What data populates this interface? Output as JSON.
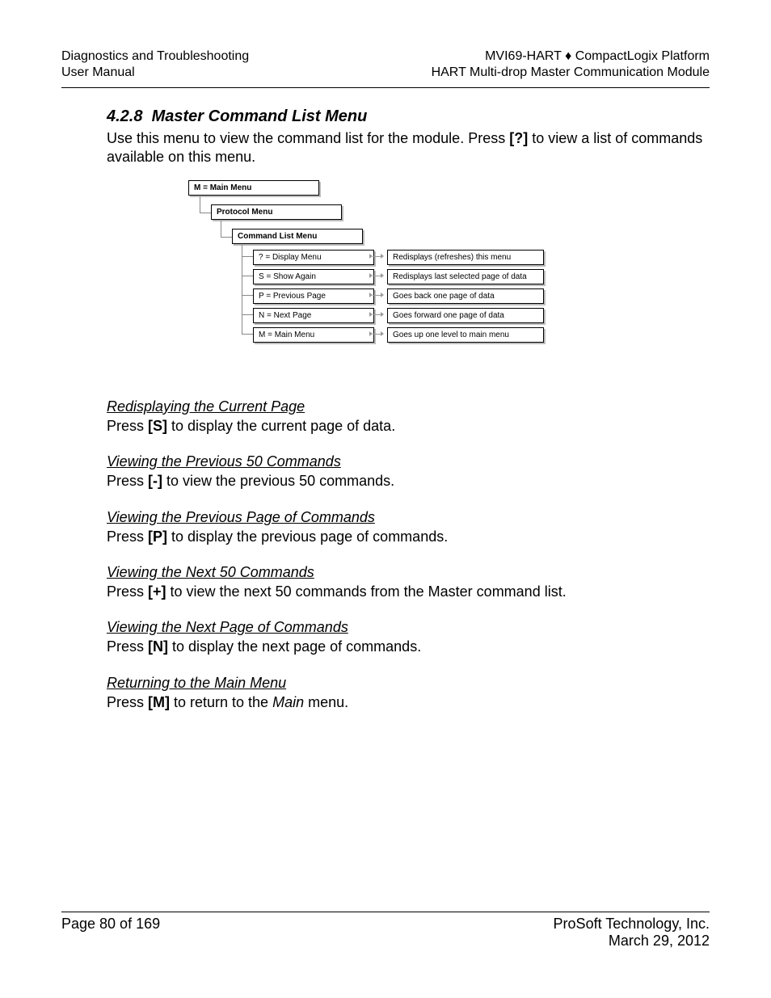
{
  "header": {
    "left1": "Diagnostics and Troubleshooting",
    "left2": "User Manual",
    "right1_a": "MVI69-HART ",
    "right1_b": " CompactLogix Platform",
    "right2": "HART Multi-drop Master Communication Module"
  },
  "section": {
    "number": "4.2.8",
    "title": "Master Command List Menu",
    "intro_a": "Use this menu to view the command list for the module. Press ",
    "intro_key": "[?]",
    "intro_b": " to view a list of commands available on this menu."
  },
  "diagram": {
    "main": "M = Main Menu",
    "proto": "Protocol Menu",
    "cmd": "Command List Menu",
    "rows": [
      {
        "left": "? = Display Menu",
        "right": "Redisplays (refreshes) this menu"
      },
      {
        "left": "S = Show Again",
        "right": "Redisplays last selected page of data"
      },
      {
        "left": "P = Previous Page",
        "right": "Goes back one page of data"
      },
      {
        "left": "N = Next Page",
        "right": "Goes forward one page of data"
      },
      {
        "left": "M = Main Menu",
        "right": "Goes up one level to main menu"
      }
    ]
  },
  "sub": [
    {
      "title": "Redisplaying the Current Page",
      "p_a": "Press ",
      "key": "[S]",
      "p_b": " to display the current page of data.",
      "tail_italic": ""
    },
    {
      "title": "Viewing the Previous 50 Commands",
      "p_a": "Press ",
      "key": "[-]",
      "p_b": " to view the previous 50 commands.",
      "tail_italic": ""
    },
    {
      "title": "Viewing the Previous Page of Commands",
      "p_a": "Press ",
      "key": "[P]",
      "p_b": " to display the previous page of commands.",
      "tail_italic": ""
    },
    {
      "title": "Viewing the Next 50 Commands",
      "p_a": "Press ",
      "key": "[+]",
      "p_b": " to view the next 50 commands from the Master command list.",
      "tail_italic": ""
    },
    {
      "title": "Viewing the Next Page of Commands",
      "p_a": "Press ",
      "key": "[N]",
      "p_b": " to display the next page of commands.",
      "tail_italic": ""
    },
    {
      "title": "Returning to the Main Menu",
      "p_a": "Press ",
      "key": "[M]",
      "p_b": " to return to the ",
      "tail_italic": "Main",
      "p_c": " menu."
    }
  ],
  "footer": {
    "left": "Page 80 of 169",
    "right1": "ProSoft Technology, Inc.",
    "right2": "March 29, 2012"
  }
}
